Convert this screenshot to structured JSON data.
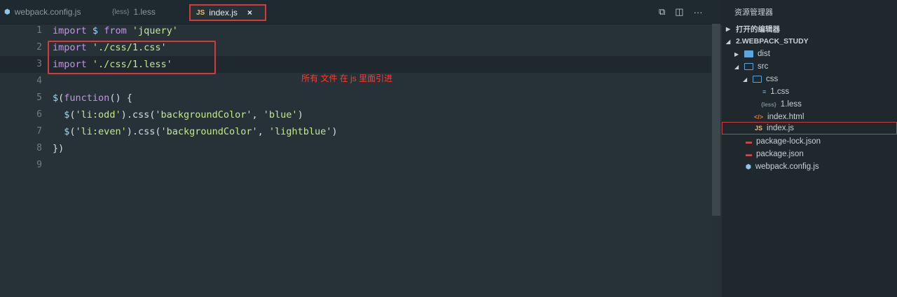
{
  "tabs": [
    {
      "label": "webpack.config.js",
      "icon": "webpack-icon",
      "active": false
    },
    {
      "label": "1.less",
      "icon": "less-icon",
      "active": false
    },
    {
      "label": "index.js",
      "icon": "js-icon",
      "active": true
    }
  ],
  "tab_close": "×",
  "explorer": {
    "title": "资源管理器",
    "open_editors": "打开的编辑器",
    "project": "2.WEBPACK_STUDY",
    "items": [
      {
        "label": "dist",
        "type": "folder",
        "icon": "folder-icon"
      },
      {
        "label": "src",
        "type": "folder-open",
        "icon": "folder-open-icon"
      },
      {
        "label": "css",
        "type": "folder-open",
        "icon": "folder-open-icon"
      },
      {
        "label": "1.css",
        "type": "css",
        "icon": "css-file-icon"
      },
      {
        "label": "1.less",
        "type": "less",
        "icon": "less-file-icon"
      },
      {
        "label": "index.html",
        "type": "html",
        "icon": "html-file-icon"
      },
      {
        "label": "index.js",
        "type": "js",
        "icon": "js-file-icon",
        "selected": true
      },
      {
        "label": "package-lock.json",
        "type": "json",
        "icon": "json-file-icon"
      },
      {
        "label": "package.json",
        "type": "json",
        "icon": "json-file-icon"
      },
      {
        "label": "webpack.config.js",
        "type": "webpack",
        "icon": "webpack-file-icon"
      }
    ]
  },
  "editor": {
    "line_numbers": [
      "1",
      "2",
      "3",
      "4",
      "5",
      "6",
      "7",
      "8",
      "9"
    ],
    "lines": [
      "import $ from 'jquery'",
      "import './css/1.css'",
      "import './css/1.less'",
      "",
      "$(function() {",
      "  $('li:odd').css('backgroundColor', 'blue')",
      "  $('li:even').css('backgroundColor', 'lightblue')",
      "})",
      ""
    ],
    "annotation": "所有 文件 在 js 里面引进"
  },
  "colors": {
    "accent_red": "#d23c3c",
    "keyword": "#c792ea",
    "string": "#c3e88d"
  }
}
